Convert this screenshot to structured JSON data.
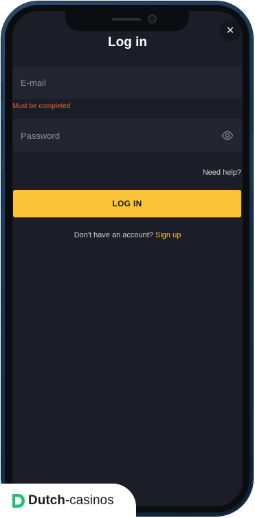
{
  "header": {
    "title": "Log in",
    "close_symbol": "✕"
  },
  "form": {
    "email": {
      "placeholder": "E-mail",
      "value": "",
      "error": "Must be completed"
    },
    "password": {
      "placeholder": "Password",
      "value": ""
    },
    "need_help": "Need help?",
    "login_button": "LOG IN"
  },
  "signup": {
    "prompt": "Don't have an account?",
    "link": "Sign up"
  },
  "watermark": {
    "brand": "Dutch",
    "suffix": "-casinos"
  },
  "icons": {
    "close": "close-icon",
    "eye": "eye-icon",
    "logo": "dutch-casinos-logo-icon"
  },
  "colors": {
    "accent": "#fcc238",
    "background": "#1c1e27",
    "input_background": "#24262f",
    "error": "#f05a3c",
    "frame": "#173452"
  }
}
